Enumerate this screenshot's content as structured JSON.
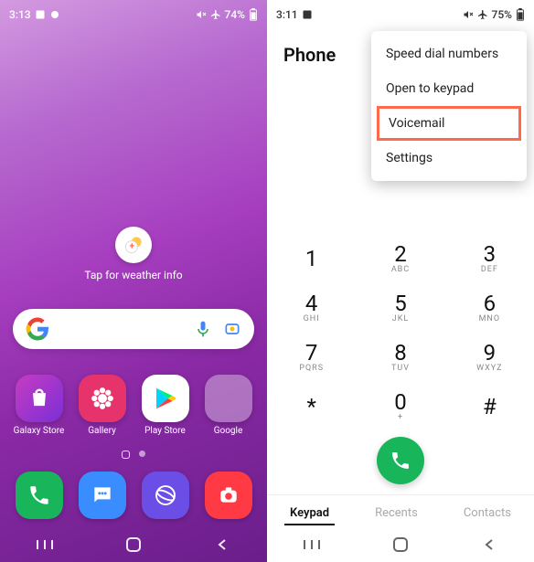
{
  "left": {
    "status": {
      "time": "3:13",
      "battery": "74%"
    },
    "weather_label": "Tap for weather info",
    "apps_row1": [
      {
        "label": "Galaxy Store"
      },
      {
        "label": "Gallery"
      },
      {
        "label": "Play Store"
      },
      {
        "label": "Google"
      }
    ],
    "apps_row2": [
      {
        "label": ""
      },
      {
        "label": ""
      },
      {
        "label": ""
      },
      {
        "label": ""
      }
    ]
  },
  "right": {
    "status": {
      "time": "3:11",
      "battery": "75%"
    },
    "title": "Phone",
    "menu": [
      "Speed dial numbers",
      "Open to keypad",
      "Voicemail",
      "Settings"
    ],
    "menu_highlighted_index": 2,
    "keypad": [
      {
        "num": "1",
        "sub": ""
      },
      {
        "num": "2",
        "sub": "ABC"
      },
      {
        "num": "3",
        "sub": "DEF"
      },
      {
        "num": "4",
        "sub": "GHI"
      },
      {
        "num": "5",
        "sub": "JKL"
      },
      {
        "num": "6",
        "sub": "MNO"
      },
      {
        "num": "7",
        "sub": "PQRS"
      },
      {
        "num": "8",
        "sub": "TUV"
      },
      {
        "num": "9",
        "sub": "WXYZ"
      },
      {
        "num": "*",
        "sub": ""
      },
      {
        "num": "0",
        "sub": "+"
      },
      {
        "num": "#",
        "sub": ""
      }
    ],
    "tabs": [
      {
        "label": "Keypad",
        "active": true
      },
      {
        "label": "Recents",
        "active": false
      },
      {
        "label": "Contacts",
        "active": false
      }
    ]
  }
}
